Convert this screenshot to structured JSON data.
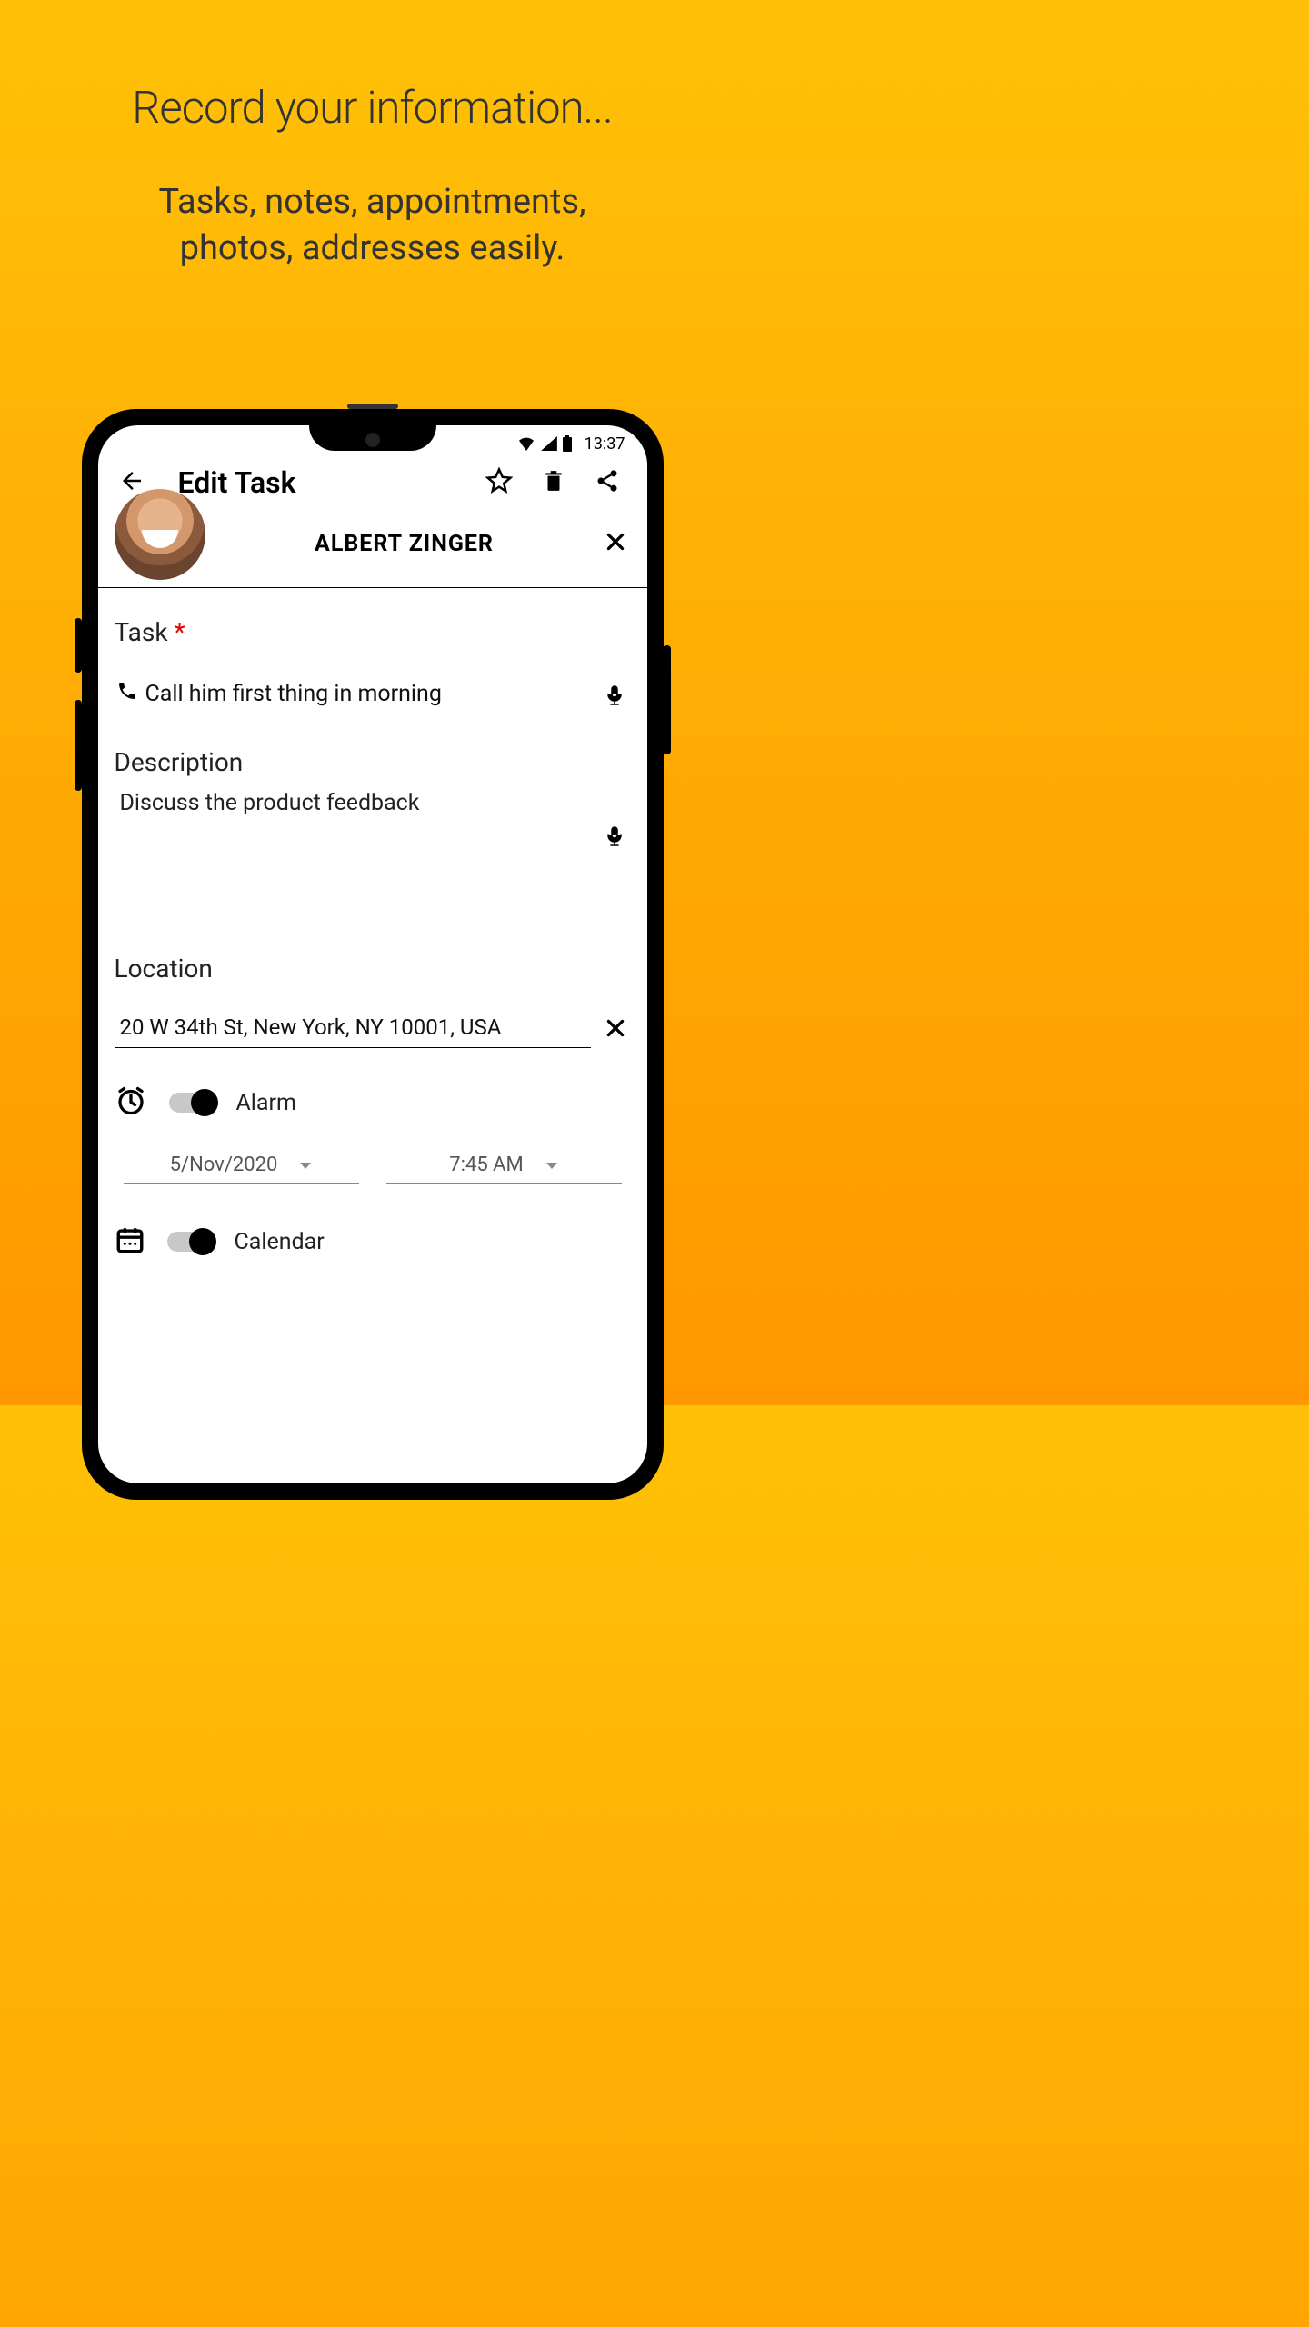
{
  "promo": {
    "title": "Record your information...",
    "subtitle_line1": "Tasks, notes, appointments,",
    "subtitle_line2": "photos, addresses easily."
  },
  "status": {
    "time": "13:37"
  },
  "appbar": {
    "title": "Edit Task"
  },
  "contact": {
    "name": "ALBERT ZINGER"
  },
  "task": {
    "label": "Task",
    "required_marker": "*",
    "value": "Call him first thing in morning"
  },
  "description": {
    "label": "Description",
    "value": "Discuss the product feedback"
  },
  "location": {
    "label": "Location",
    "value": "20 W 34th St, New York, NY 10001, USA"
  },
  "alarm": {
    "label": "Alarm",
    "date": "5/Nov/2020",
    "time": "7:45 AM"
  },
  "calendar": {
    "label": "Calendar"
  }
}
